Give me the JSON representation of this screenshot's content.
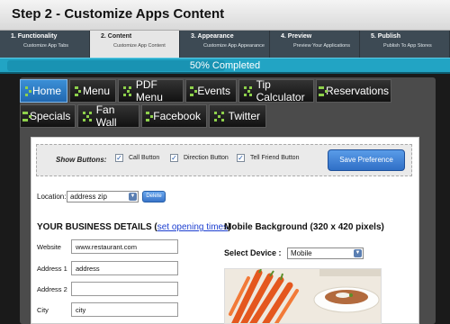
{
  "header": {
    "title": "Step 2 - Customize Apps Content"
  },
  "steps": [
    {
      "title": "1. Functionality",
      "subtitle": "Customize App Tabs"
    },
    {
      "title": "2. Content",
      "subtitle": "Customize App Content"
    },
    {
      "title": "3. Appearance",
      "subtitle": "Customize App Appearance"
    },
    {
      "title": "4. Preview",
      "subtitle": "Preview Your Applications"
    },
    {
      "title": "5. Publish",
      "subtitle": "Publish To App Stores"
    }
  ],
  "active_step": 1,
  "progress": {
    "label": "50% Completed",
    "fraction": 0.5
  },
  "tabs": {
    "row1": [
      "Home",
      "Menu",
      "PDF Menu",
      "Events",
      "Tip Calculator",
      "Reservations"
    ],
    "row2": [
      "Specials",
      "Fan Wall",
      "Facebook",
      "Twitter"
    ],
    "active": "Home"
  },
  "show_buttons": {
    "label": "Show Buttons:",
    "options": [
      {
        "label": "Call Button",
        "checked": true
      },
      {
        "label": "Direction Button",
        "checked": true
      },
      {
        "label": "Tell Friend Button",
        "checked": true
      }
    ],
    "save_label": "Save Preference"
  },
  "location": {
    "label": "Location:",
    "selected": "address zip",
    "delete_label": "Delete"
  },
  "business": {
    "heading": "YOUR BUSINESS DETAILS",
    "link_open": "(",
    "link_text": "set opening times",
    "link_close": ")",
    "fields": [
      {
        "label": "Website",
        "value": "www.restaurant.com"
      },
      {
        "label": "Address 1",
        "value": "address"
      },
      {
        "label": "Address 2",
        "value": ""
      },
      {
        "label": "City",
        "value": "city"
      }
    ]
  },
  "mobile_background": {
    "heading": "Mobile Background (320 x 420 pixels)",
    "device_label": "Select Device :",
    "device_selected": "Mobile"
  },
  "colors": {
    "accent": "#22a4c4",
    "active_tab": "#2f7cc5",
    "link": "#1d3fd0"
  },
  "icons": {
    "tab_icon": "move-arrows-icon",
    "dropdown": "chevron-down-icon",
    "check": "checkmark-icon"
  }
}
